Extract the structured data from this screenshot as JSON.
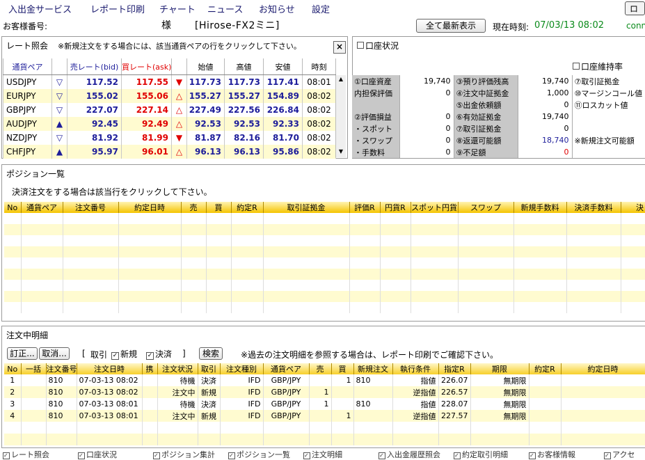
{
  "menu": [
    "入出金サービス",
    "レポート印刷",
    "チャート",
    "ニュース",
    "お知らせ",
    "設定"
  ],
  "logout_label": "ログ",
  "header": {
    "customer_label": "お客様番号:",
    "honorific": "様",
    "account_name": "[Hirose-FX2ミニ]",
    "refresh_button": "全て最新表示",
    "time_label": "現在時刻:",
    "time_value": "07/03/13 08:02",
    "conn": "conn"
  },
  "rate_panel": {
    "title": "レート照会",
    "note": "※新規注文をする場合には、該当通貨ペアの行をクリックして下さい。",
    "close": "×",
    "columns": [
      "通貨ペア",
      "",
      "売レート(bid)",
      "買レート(ask)",
      "",
      "始値",
      "高値",
      "安値",
      "時刻"
    ],
    "rows": [
      {
        "pair": "USDJPY",
        "bid_arrow": "▽",
        "bid": "117.52",
        "ask": "117.55",
        "ask_arrow": "▼",
        "open": "117.73",
        "high": "117.73",
        "low": "117.41",
        "time": "08:01"
      },
      {
        "pair": "EURJPY",
        "bid_arrow": "▽",
        "bid": "155.02",
        "ask": "155.06",
        "ask_arrow": "△",
        "open": "155.27",
        "high": "155.27",
        "low": "154.89",
        "time": "08:02"
      },
      {
        "pair": "GBPJPY",
        "bid_arrow": "▽",
        "bid": "227.07",
        "ask": "227.14",
        "ask_arrow": "△",
        "open": "227.49",
        "high": "227.56",
        "low": "226.84",
        "time": "08:02"
      },
      {
        "pair": "AUDJPY",
        "bid_arrow": "▲",
        "bid": "92.45",
        "ask": "92.49",
        "ask_arrow": "△",
        "open": "92.53",
        "high": "92.53",
        "low": "92.33",
        "time": "08:02"
      },
      {
        "pair": "NZDJPY",
        "bid_arrow": "▽",
        "bid": "81.92",
        "ask": "81.99",
        "ask_arrow": "▼",
        "open": "81.87",
        "high": "82.16",
        "low": "81.70",
        "time": "08:02"
      },
      {
        "pair": "CHFJPY",
        "bid_arrow": "▲",
        "bid": "95.97",
        "ask": "96.01",
        "ask_arrow": "△",
        "open": "96.13",
        "high": "96.13",
        "low": "95.86",
        "time": "08:02"
      }
    ]
  },
  "account_panel": {
    "title": "口座状況",
    "maint_title": "口座維持率",
    "rows": [
      {
        "l1": "①口座資産",
        "v1": "19,740",
        "l2": "③預り評価残高",
        "v2": "19,740",
        "l3": "⑦取引証拠金"
      },
      {
        "l1": "内担保評価",
        "v1": "0",
        "l2": "④注文中証拠金",
        "v2": "1,000",
        "l3": "⑩マージンコール値"
      },
      {
        "l1": "",
        "v1": "",
        "l2": "⑤出金依頼額",
        "v2": "0",
        "l3": "⑪ロスカット値"
      },
      {
        "l1": "②評価損益",
        "v1": "0",
        "l2": "⑥有効証拠金",
        "v2": "19,740",
        "l3": ""
      },
      {
        "l1": "・スポット",
        "v1": "0",
        "l2": "⑦取引証拠金",
        "v2": "0",
        "l3": ""
      },
      {
        "l1": "・スワップ",
        "v1": "0",
        "l2": "⑧返還可能額",
        "v2": "18,740",
        "l3": "※新規注文可能額"
      },
      {
        "l1": "・手数料",
        "v1": "0",
        "l2": "⑨不足額",
        "v2": "0",
        "l3": ""
      }
    ]
  },
  "position_panel": {
    "title": "ポジション一覧",
    "note": "決済注文をする場合は該当行をクリックして下さい。",
    "columns": [
      "No",
      "通貨ペア",
      "注文番号",
      "約定日時",
      "売",
      "買",
      "約定R",
      "取引証拠金",
      "評価R",
      "円貨R",
      "スポット円貨",
      "スワップ",
      "新規手数料",
      "決済手数料",
      "決"
    ]
  },
  "order_panel": {
    "title": "注文中明細",
    "modify_button": "訂正...",
    "cancel_button": "取消...",
    "bracket_open": "[",
    "filter_label": "取引",
    "new_label": "新規",
    "close_label": "決済",
    "bracket_close": "]",
    "search_button": "検索",
    "note": "※過去の注文明細を参照する場合は、レポート印刷でご確認下さい。",
    "columns": [
      "No",
      "一括",
      "注文番号",
      "注文日時",
      "携",
      "注文状況",
      "取引",
      "注文種別",
      "通貨ペア",
      "売",
      "買",
      "新規注文",
      "執行条件",
      "指定R",
      "期限",
      "約定R",
      "約定日時"
    ],
    "rows": [
      {
        "no": "1",
        "order_no": "810",
        "dt": "07-03-13 08:02",
        "status": "待機",
        "trade": "決済",
        "type": "IFD",
        "pair": "GBP/JPY",
        "sell": "",
        "buy": "1",
        "new_order": "810",
        "cond": "指値",
        "rate": "226.07",
        "limit": "無期限"
      },
      {
        "no": "2",
        "order_no": "810",
        "dt": "07-03-13 08:02",
        "status": "注文中",
        "trade": "新規",
        "type": "IFD",
        "pair": "GBP/JPY",
        "sell": "1",
        "buy": "",
        "new_order": "",
        "cond": "逆指値",
        "rate": "226.57",
        "limit": "無期限"
      },
      {
        "no": "3",
        "order_no": "810",
        "dt": "07-03-13 08:01",
        "status": "待機",
        "trade": "決済",
        "type": "IFD",
        "pair": "GBP/JPY",
        "sell": "1",
        "buy": "",
        "new_order": "810",
        "cond": "指値",
        "rate": "228.07",
        "limit": "無期限"
      },
      {
        "no": "4",
        "order_no": "810",
        "dt": "07-03-13 08:01",
        "status": "注文中",
        "trade": "新規",
        "type": "IFD",
        "pair": "GBP/JPY",
        "sell": "",
        "buy": "1",
        "new_order": "",
        "cond": "逆指値",
        "rate": "227.57",
        "limit": "無期限"
      }
    ]
  },
  "footer_tabs": [
    "レート照会",
    "口座状況",
    "ポジション集計",
    "ポジション一覧",
    "注文明細",
    "入出金履歴照会",
    "約定取引明細",
    "お客様情報",
    "アクセ"
  ],
  "colors": {
    "bid": "#1d1d9a",
    "ask": "#e00000",
    "stripe": "#fffbd0",
    "grid_head": "#f5c400",
    "acct_gray": "#c8c8c8"
  }
}
